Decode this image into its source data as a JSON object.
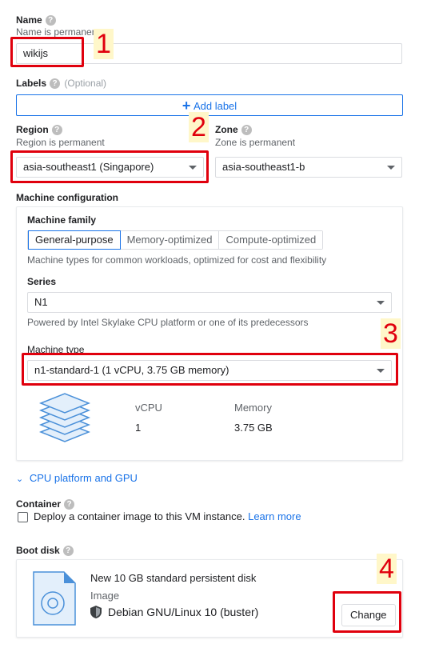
{
  "name": {
    "label": "Name",
    "hint": "Name is permanent",
    "value": "wikijs"
  },
  "labels": {
    "label": "Labels",
    "optional": "(Optional)",
    "add_button": "Add label",
    "add_icon": "plus-icon"
  },
  "region": {
    "label": "Region",
    "hint": "Region is permanent",
    "value": "asia-southeast1 (Singapore)"
  },
  "zone": {
    "label": "Zone",
    "hint": "Zone is permanent",
    "value": "asia-southeast1-b"
  },
  "machine_config": {
    "label": "Machine configuration",
    "family_label": "Machine family",
    "family_tabs": [
      "General-purpose",
      "Memory-optimized",
      "Compute-optimized"
    ],
    "family_active": "General-purpose",
    "family_hint": "Machine types for common workloads, optimized for cost and flexibility",
    "series_label": "Series",
    "series_value": "N1",
    "series_hint": "Powered by Intel Skylake CPU platform or one of its predecessors",
    "type_label": "Machine type",
    "type_value": "n1-standard-1 (1 vCPU, 3.75 GB memory)",
    "vcpu_header": "vCPU",
    "vcpu_value": "1",
    "memory_header": "Memory",
    "memory_value": "3.75 GB"
  },
  "cpu_platform": {
    "label": "CPU platform and GPU",
    "icon": "chevron-double-down-icon"
  },
  "container": {
    "label": "Container",
    "checkbox_text": "Deploy a container image to this VM instance.",
    "learn_more": "Learn more"
  },
  "boot_disk": {
    "label": "Boot disk",
    "title": "New 10 GB standard persistent disk",
    "image_label": "Image",
    "image_value": "Debian GNU/Linux 10 (buster)",
    "change_button": "Change"
  },
  "callouts": [
    "1",
    "2",
    "3",
    "4"
  ],
  "colors": {
    "accent": "#1a73e8",
    "highlight": "#e0000d",
    "callout_bg": "#fff7c9",
    "icon_blue": "#4a90d9"
  }
}
